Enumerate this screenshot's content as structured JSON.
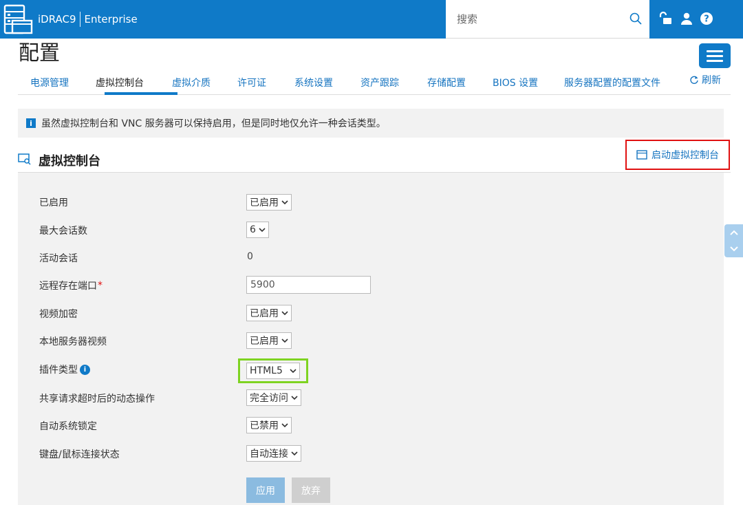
{
  "header": {
    "product": "iDRAC9",
    "edition": "Enterprise",
    "search_placeholder": "搜索",
    "icons": [
      "server-logo-icon",
      "search-icon",
      "unlock-icon",
      "user-icon",
      "help-icon"
    ]
  },
  "page": {
    "title": "配置",
    "refresh_label": "刷新"
  },
  "tabs": [
    {
      "label": "电源管理"
    },
    {
      "label": "虚拟控制台"
    },
    {
      "label": "虚拟介质"
    },
    {
      "label": "许可证"
    },
    {
      "label": "系统设置"
    },
    {
      "label": "资产跟踪"
    },
    {
      "label": "存储配置"
    },
    {
      "label": "BIOS 设置"
    },
    {
      "label": "服务器配置的配置文件"
    }
  ],
  "active_tab": 1,
  "info_banner": "虽然虚拟控制台和 VNC 服务器可以保持启用，但是同时地仅允许一种会话类型。",
  "section": {
    "title": "虚拟控制台",
    "launch_label": "启动虚拟控制台"
  },
  "form": {
    "enabled": {
      "label": "已启用",
      "value": "已启用"
    },
    "max_sessions": {
      "label": "最大会话数",
      "value": "6"
    },
    "active_sessions": {
      "label": "活动会话",
      "value": "0"
    },
    "remote_port": {
      "label": "远程存在端口",
      "required_mark": "*",
      "value": "5900"
    },
    "video_encryption": {
      "label": "视频加密",
      "value": "已启用"
    },
    "local_video": {
      "label": "本地服务器视频",
      "value": "已启用"
    },
    "plugin_type": {
      "label": "插件类型",
      "value": "HTML5"
    },
    "shared_timeout_action": {
      "label": "共享请求超时后的动态操作",
      "value": "完全访问"
    },
    "auto_lock": {
      "label": "自动系统锁定",
      "value": "已禁用"
    },
    "kvm_status": {
      "label": "键盘/鼠标连接状态",
      "value": "自动连接"
    }
  },
  "buttons": {
    "apply": "应用",
    "discard": "放弃"
  },
  "colors": {
    "brand_blue": "#0f7ac8",
    "highlight_red": "#e01010",
    "highlight_green": "#7ed321"
  }
}
